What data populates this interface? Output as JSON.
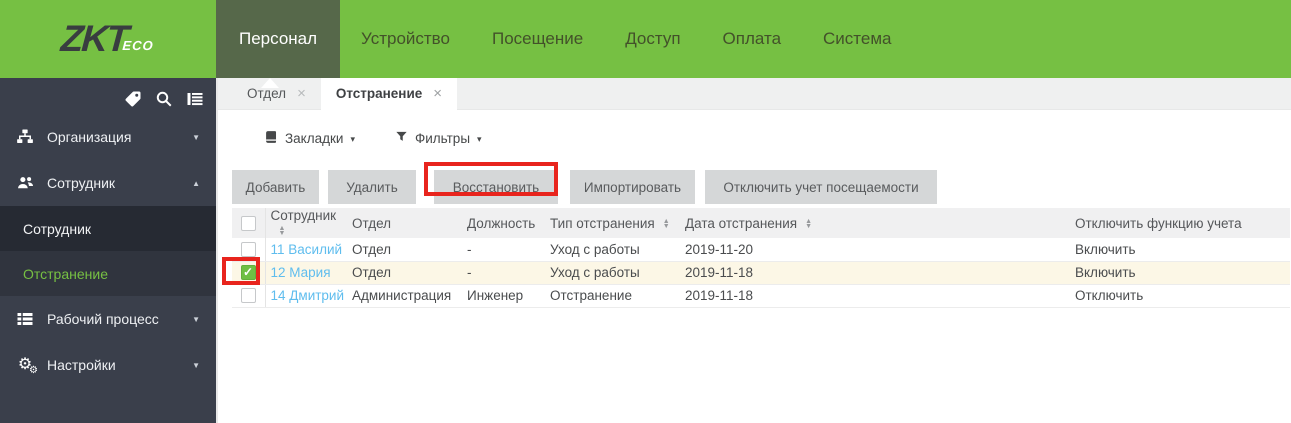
{
  "brand": {
    "logo_zkt": "ZKT",
    "logo_eco": "ECO"
  },
  "colors": {
    "accent_green": "#76c043",
    "active_nav_green": "#56684a",
    "sidebar_bg": "#3a3f4b",
    "annotation_red": "#e8241d",
    "link_blue": "#5fbdee",
    "selected_row_bg": "#fcf7e6",
    "checked_checkbox_green": "#6fbf44"
  },
  "icons": {
    "caret_down": "▾",
    "chevron_down": "▼",
    "chevron_up": "▲",
    "sort_asc": "▲",
    "sort_desc": "▼",
    "close": "×",
    "check": "✓",
    "gear": "⚙"
  },
  "top_nav": {
    "items": [
      {
        "label": "Персонал",
        "active": true
      },
      {
        "label": "Устройство",
        "active": false
      },
      {
        "label": "Посещение",
        "active": false
      },
      {
        "label": "Доступ",
        "active": false
      },
      {
        "label": "Оплата",
        "active": false
      },
      {
        "label": "Система",
        "active": false
      }
    ]
  },
  "sidebar": {
    "quick_icons": [
      "tag-icon",
      "search-icon",
      "panel-list-icon"
    ],
    "groups": [
      {
        "label": "Организация",
        "expanded": false
      },
      {
        "label": "Сотрудник",
        "expanded": true,
        "children": [
          {
            "label": "Сотрудник",
            "active": false
          },
          {
            "label": "Отстранение",
            "active": true
          }
        ]
      },
      {
        "label": "Рабочий процесс",
        "expanded": false
      },
      {
        "label": "Настройки",
        "expanded": false
      }
    ]
  },
  "content": {
    "tabs": [
      {
        "label": "Отдел",
        "active": false
      },
      {
        "label": "Отстранение",
        "active": true
      }
    ],
    "toolbar": {
      "bookmarks": "Закладки",
      "filters": "Фильтры"
    },
    "action_buttons": [
      {
        "label": "Добавить"
      },
      {
        "label": "Удалить"
      },
      {
        "label": "Восстановить",
        "highlighted": true
      },
      {
        "label": "Импортировать"
      },
      {
        "label": "Отключить учет посещаемости"
      }
    ],
    "table": {
      "columns": [
        {
          "label": "",
          "sortable": false
        },
        {
          "label": "Сотрудник",
          "sortable": true
        },
        {
          "label": "Отдел",
          "sortable": false
        },
        {
          "label": "Должность",
          "sortable": false
        },
        {
          "label": "Тип отстранения",
          "sortable": true
        },
        {
          "label": "Дата отстранения",
          "sortable": true
        },
        {
          "label": "Отключить функцию учета",
          "sortable": false
        }
      ],
      "rows": [
        {
          "checked": false,
          "selected": false,
          "employee": "11 Василий",
          "department": "Отдел",
          "position": "-",
          "type": "Уход с работы",
          "date": "2019-11-20",
          "attendance": "Включить"
        },
        {
          "checked": true,
          "selected": true,
          "employee": "12 Мария",
          "department": "Отдел",
          "position": "-",
          "type": "Уход с работы",
          "date": "2019-11-18",
          "attendance": "Включить"
        },
        {
          "checked": false,
          "selected": false,
          "employee": "14 Дмитрий",
          "department": "Администрация",
          "position": "Инженер",
          "type": "Отстранение",
          "date": "2019-11-18",
          "attendance": "Отключить"
        }
      ]
    }
  },
  "annotations": {
    "highlight_color": "#e8241d",
    "boxes": [
      {
        "target": "restore-button"
      },
      {
        "target": "row-2-checkbox"
      }
    ]
  }
}
